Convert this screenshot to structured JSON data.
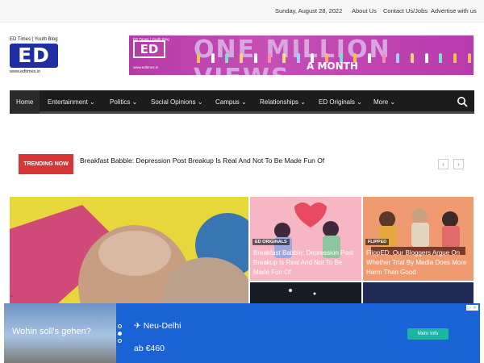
{
  "topbar": {
    "date": "Sunday, August 28, 2022",
    "links": [
      "About Us",
      "Contact Us/Jobs",
      "Advertise with us"
    ]
  },
  "logo": {
    "tagline": "ED Times | Youth Blog",
    "mark": "ED",
    "url": "www.edtimes.in"
  },
  "banner": {
    "mini_tag": "ED Times | Youth Blog",
    "mini_mark": "ED",
    "mini_url": "www.edtimes.in",
    "headline": "ONE MILLION VIEWS",
    "subline": "A MONTH"
  },
  "nav": {
    "items": [
      "Home",
      "Entertainment",
      "Politics",
      "Social Opinions",
      "Campus",
      "Relationships",
      "ED Originals",
      "More"
    ],
    "chevron": "chevron-down-icon",
    "search_icon": "search-icon"
  },
  "trending": {
    "label": "TRENDING NOW",
    "headline": "Breakfast Babble: Depression Post Breakup Is Real And Not To Be Made Fun Of",
    "prev": "‹",
    "next": "›"
  },
  "tiles": [
    {
      "category": "ED ORIGINALS",
      "title": "Breakfast Babble: Depression Post Breakup Is Real And Not To Be Made Fun Of"
    },
    {
      "category": "FLIPPED",
      "title": "FlippED: Our Bloggers Argue On Whether Trial By Media Does More Harm Than Good"
    }
  ],
  "ad": {
    "question": "Wohin soll's gehen?",
    "city": "✈ Neu-Delhi",
    "price": "ab €460",
    "button": "Mehr Info",
    "adchoices": "▷ ✕"
  },
  "colors": {
    "nav_bg": "#1c1c1c",
    "trending_red": "#d83636",
    "ad_blue": "#1a63d6",
    "cta_teal": "#1bb5a2",
    "logo_blue": "#1f2fa3"
  }
}
